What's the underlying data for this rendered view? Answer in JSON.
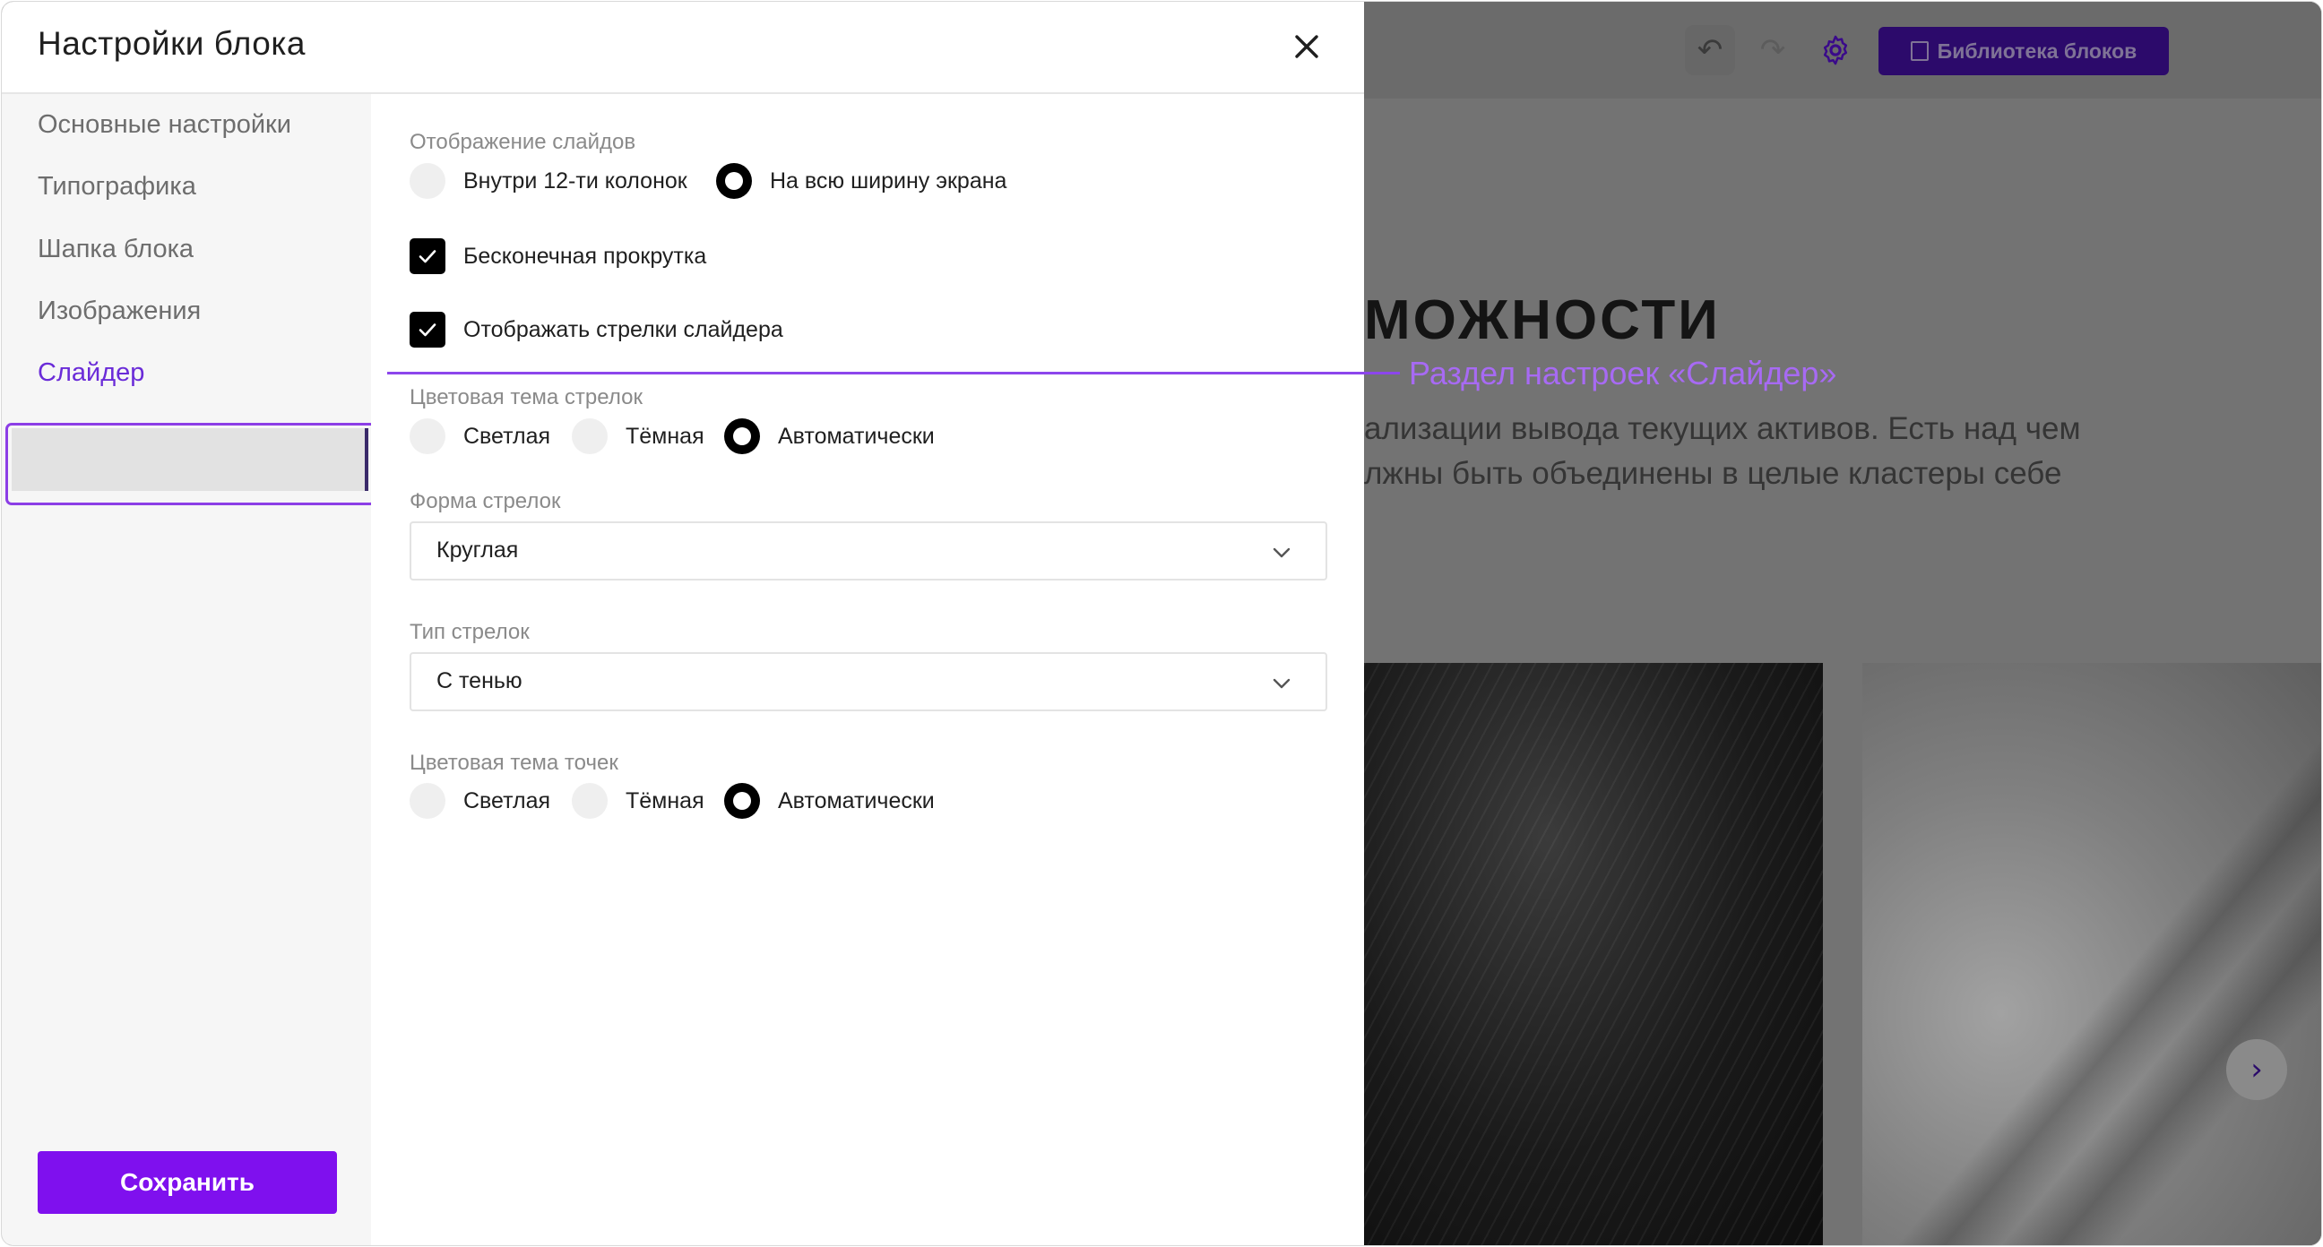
{
  "background_page": {
    "toolbar": {
      "undo_icon": "undo-icon",
      "redo_icon": "redo-icon",
      "settings_icon": "gear-icon",
      "library_button_label": "Библиотека блоков",
      "accent_color": "#2c0a6b"
    },
    "heading_fragment": "МОЖНОСТИ",
    "text_lines": [
      "ализации вывода текущих активов. Есть над чем",
      "лжны быть объединены в целые кластеры себе"
    ],
    "slider_next_icon": "chevron-right-icon"
  },
  "annotation": {
    "label": "Раздел настроек «Слайдер»",
    "color": "#a76af3"
  },
  "dialog": {
    "title": "Настройки блока",
    "close_icon": "close-icon",
    "sidebar": {
      "items": [
        {
          "label": "Основные настройки",
          "active": false
        },
        {
          "label": "Типографика",
          "active": false
        },
        {
          "label": "Шапка блока",
          "active": false
        },
        {
          "label": "Изображения",
          "active": false
        },
        {
          "label": "Слайдер",
          "active": true
        }
      ],
      "save_label": "Сохранить",
      "accent_color": "#7f10ee"
    },
    "settings": {
      "slide_display": {
        "label": "Отображение слайдов",
        "options": [
          "Внутри 12-ти колонок",
          "На всю ширину экрана"
        ],
        "selected": "На всю ширину экрана"
      },
      "infinite_scroll": {
        "label": "Бесконечная прокрутка",
        "checked": true
      },
      "show_arrows": {
        "label": "Отображать стрелки слайдера",
        "checked": true
      },
      "arrow_color_theme": {
        "label": "Цветовая тема стрелок",
        "options": [
          "Светлая",
          "Тёмная",
          "Автоматически"
        ],
        "selected": "Автоматически"
      },
      "arrow_shape": {
        "label": "Форма стрелок",
        "value": "Круглая"
      },
      "arrow_type": {
        "label": "Тип стрелок",
        "value": "С тенью"
      },
      "dot_color_theme": {
        "label": "Цветовая тема точек",
        "options": [
          "Светлая",
          "Тёмная",
          "Автоматически"
        ],
        "selected": "Автоматически"
      }
    }
  }
}
